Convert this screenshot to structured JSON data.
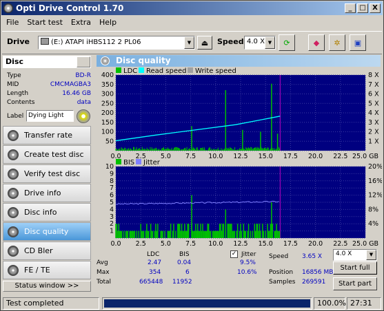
{
  "window": {
    "title": "Opti Drive Control 1.70",
    "min": "_",
    "max": "□",
    "close": "X"
  },
  "menu": [
    "File",
    "Start test",
    "Extra",
    "Help"
  ],
  "toolbar": {
    "drive_label": "Drive",
    "drive_value": "(E:)   ATAPI iHBS112   2 PL06",
    "speed_label": "Speed",
    "speed_value": "4.0 X"
  },
  "disc": {
    "header": "Disc",
    "rows": [
      {
        "k": "Type",
        "v": "BD-R"
      },
      {
        "k": "MID",
        "v": "CMCMAGBA3"
      },
      {
        "k": "Length",
        "v": "16.46 GB"
      },
      {
        "k": "Contents",
        "v": "data"
      }
    ],
    "label_key": "Label",
    "label_value": "Dying Light"
  },
  "nav": [
    "Transfer rate",
    "Create test disc",
    "Verify test disc",
    "Drive info",
    "Disc info",
    "Disc quality",
    "CD Bler",
    "FE / TE"
  ],
  "nav_active": 5,
  "status_window_btn": "Status window >>",
  "main": {
    "title": "Disc quality"
  },
  "chart_data": [
    {
      "type": "bar+line",
      "legend": [
        "LDC",
        "Read speed",
        "Write speed"
      ],
      "colors": {
        "LDC": "#00c000",
        "Read speed": "#00ffff",
        "Write speed": "#a0a0a0"
      },
      "x_ticks": [
        "0.0",
        "2.5",
        "5.0",
        "7.5",
        "10.0",
        "12.5",
        "15.0",
        "17.5",
        "20.0",
        "22.5",
        "25.0 GB"
      ],
      "xlim": [
        0,
        25
      ],
      "y_ticks": [
        "400",
        "350",
        "300",
        "250",
        "200",
        "150",
        "100",
        "50"
      ],
      "ylim": [
        0,
        400
      ],
      "y2_ticks": [
        "8 X",
        "7 X",
        "6 X",
        "5 X",
        "4 X",
        "3 X",
        "2 X",
        "1 X"
      ],
      "y2lim": [
        0,
        8
      ],
      "ldc_spikes": [
        {
          "x": 7.6,
          "y": 130
        },
        {
          "x": 11.0,
          "y": 320
        },
        {
          "x": 12.7,
          "y": 110
        },
        {
          "x": 14.5,
          "y": 100
        },
        {
          "x": 15.6,
          "y": 354
        },
        {
          "x": 16.2,
          "y": 90
        }
      ],
      "read_speed": [
        {
          "x": 0,
          "y": 1.05
        },
        {
          "x": 4,
          "y": 1.65
        },
        {
          "x": 8,
          "y": 2.2
        },
        {
          "x": 12,
          "y": 2.75
        },
        {
          "x": 16.46,
          "y": 3.65
        }
      ],
      "end_marker_x": 16.46
    },
    {
      "type": "bar+line",
      "legend": [
        "BIS",
        "Jitter"
      ],
      "colors": {
        "BIS": "#00c000",
        "Jitter": "#8080ff"
      },
      "x_ticks": [
        "0.0",
        "2.5",
        "5.0",
        "7.5",
        "10.0",
        "12.5",
        "15.0",
        "17.5",
        "20.0",
        "22.5",
        "25.0 GB"
      ],
      "xlim": [
        0,
        25
      ],
      "y_ticks": [
        "10",
        "9",
        "8",
        "7",
        "6",
        "5",
        "4",
        "3",
        "2",
        "1"
      ],
      "ylim": [
        0,
        10
      ],
      "y2_ticks": [
        "20%",
        "16%",
        "12%",
        "8%",
        "4%"
      ],
      "y2lim": [
        0,
        20
      ],
      "bis_spikes": [
        {
          "x": 7.6,
          "y": 6
        },
        {
          "x": 11.0,
          "y": 4
        },
        {
          "x": 15.6,
          "y": 5
        }
      ],
      "jitter": [
        {
          "x": 0,
          "y": 9.5
        },
        {
          "x": 8,
          "y": 9.8
        },
        {
          "x": 16.46,
          "y": 10.2
        }
      ],
      "end_marker_x": 16.46
    }
  ],
  "stats": {
    "h_ldc": "LDC",
    "h_bis": "BIS",
    "jitter_label": "Jitter",
    "jitter_checked": true,
    "avg_label": "Avg",
    "avg_ldc": "2.47",
    "avg_bis": "0.04",
    "avg_jit": "9.5%",
    "max_label": "Max",
    "max_ldc": "354",
    "max_bis": "6",
    "max_jit": "10.6%",
    "total_label": "Total",
    "total_ldc": "665448",
    "total_bis": "11952",
    "speed_label": "Speed",
    "speed_value": "3.65 X",
    "speed_combo": "4.0 X",
    "position_label": "Position",
    "position_value": "16856 MB",
    "samples_label": "Samples",
    "samples_value": "269591",
    "start_full": "Start full",
    "start_part": "Start part"
  },
  "statusbar": {
    "text": "Test completed",
    "progress": 1.0,
    "progress_text": "100.0%",
    "time": "27:31"
  }
}
